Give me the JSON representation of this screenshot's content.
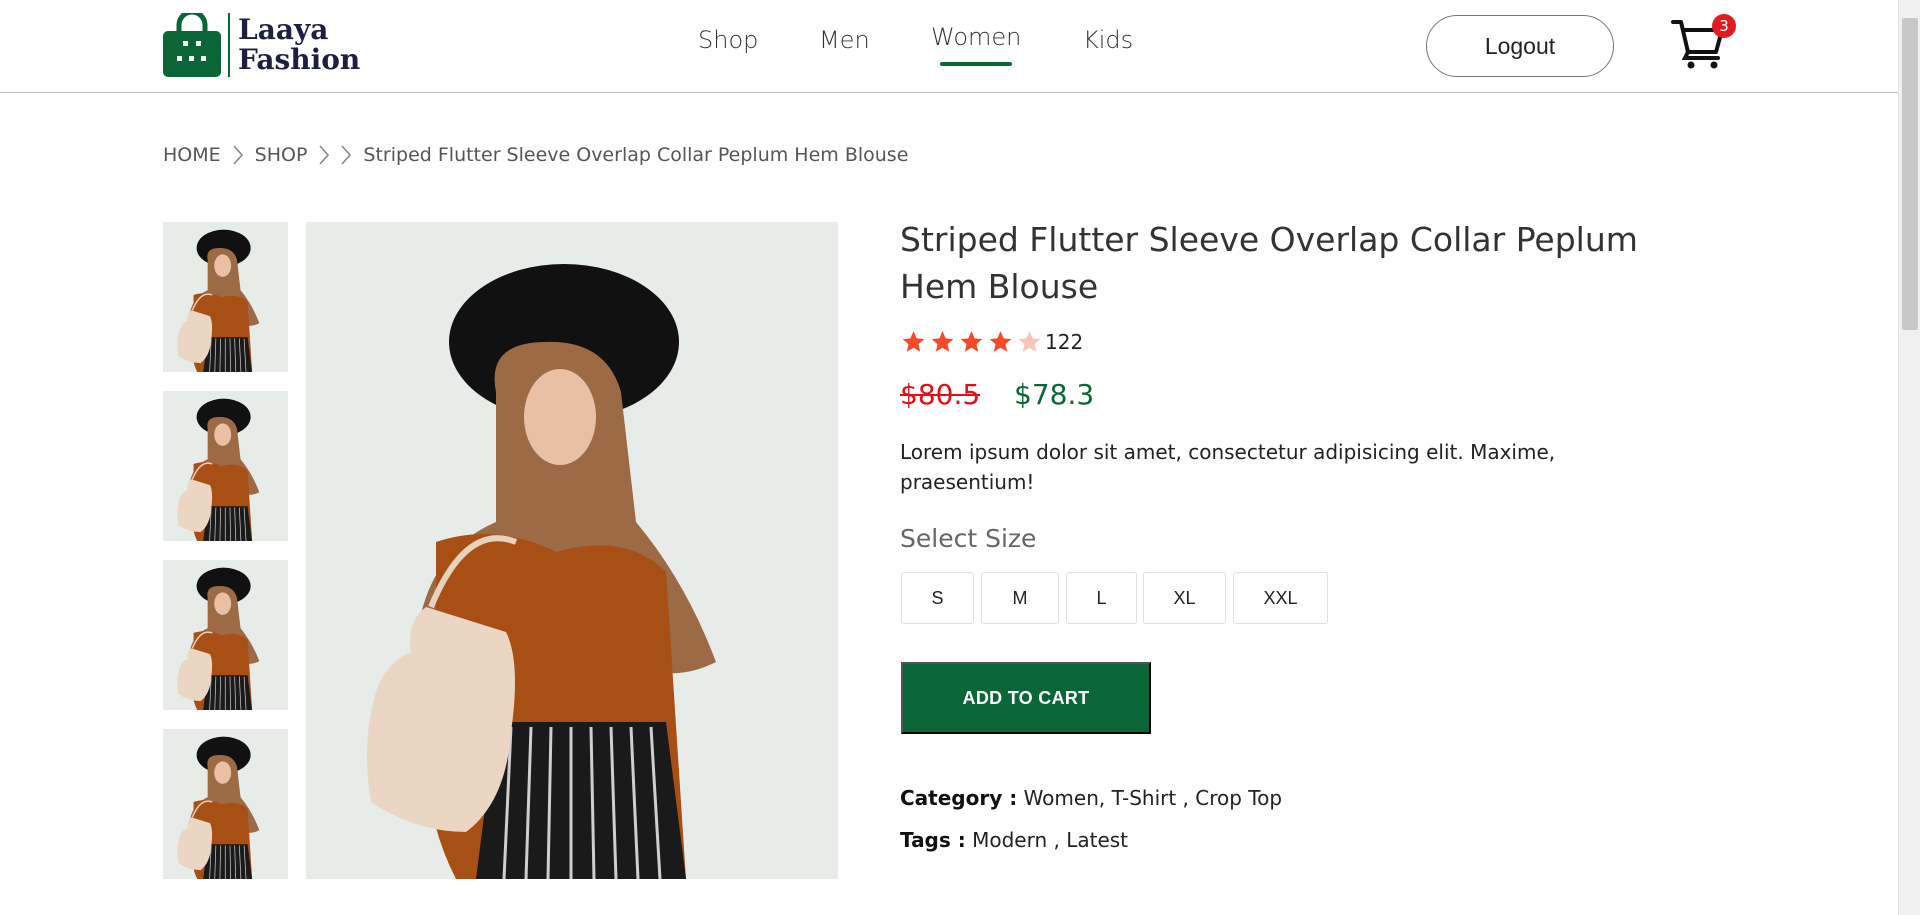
{
  "brand": {
    "line1": "Laaya",
    "line2": "Fashion",
    "color": "#0b6637"
  },
  "nav": {
    "items": [
      {
        "label": "Shop",
        "active": false
      },
      {
        "label": "Men",
        "active": false
      },
      {
        "label": "Women",
        "active": true
      },
      {
        "label": "Kids",
        "active": false
      }
    ]
  },
  "header": {
    "logout_label": "Logout",
    "cart_count": "3",
    "cart_icon": "cart-icon"
  },
  "breadcrumb": [
    "HOME",
    "SHOP",
    "Striped Flutter Sleeve Overlap Collar Peplum Hem Blouse"
  ],
  "product": {
    "title": "Striped Flutter Sleeve Overlap Collar Peplum Hem Blouse",
    "rating": 4,
    "rating_max": 5,
    "review_count": "122",
    "old_price": "$80.5",
    "new_price": "$78.3",
    "description": "Lorem ipsum dolor sit amet, consectetur adipisicing elit. Maxime, praesentium!",
    "size_label": "Select Size",
    "sizes": [
      "S",
      "M",
      "L",
      "XL",
      "XXL"
    ],
    "add_to_cart": "ADD TO CART",
    "category_label": "Category :",
    "category_value": " Women, T-Shirt , Crop Top",
    "tags_label": "Tags :",
    "tags_value": " Modern , Latest"
  },
  "colors": {
    "accent": "#0b6637",
    "sale": "#e20f16",
    "star": "#f44a2a",
    "star_empty": "#f8c4b8",
    "badge": "#e11b22"
  }
}
